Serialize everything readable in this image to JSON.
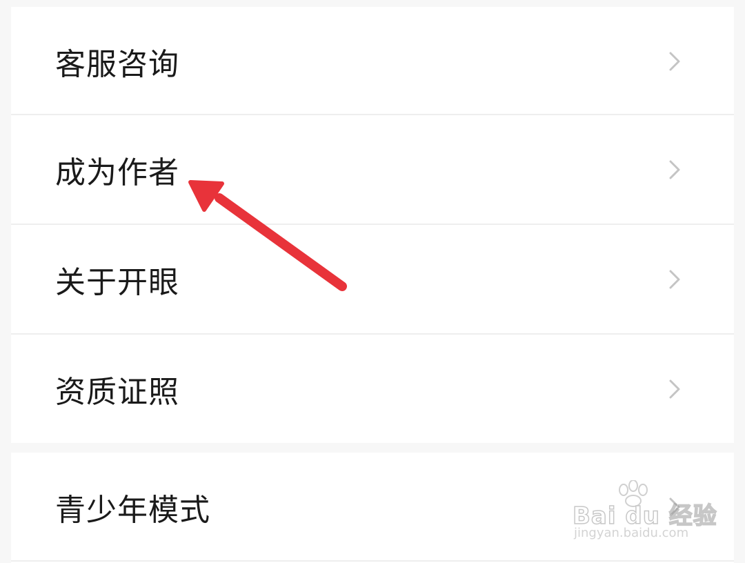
{
  "menu": {
    "group1": [
      {
        "label": "客服咨询"
      },
      {
        "label": "成为作者"
      },
      {
        "label": "关于开眼"
      },
      {
        "label": "资质证照"
      }
    ],
    "group2": [
      {
        "label": "青少年模式"
      }
    ]
  },
  "icons": {
    "row_chevron": "chevron-right-icon",
    "annotation": "red-arrow-annotation"
  },
  "colors": {
    "background": "#f7f7f7",
    "card": "#ffffff",
    "text": "#1a1a1a",
    "chevron": "#c4c4c4",
    "arrow": "#e8333a"
  },
  "watermark": {
    "brand": "Bai du 经验",
    "url": "jingyan.baidu.com"
  }
}
